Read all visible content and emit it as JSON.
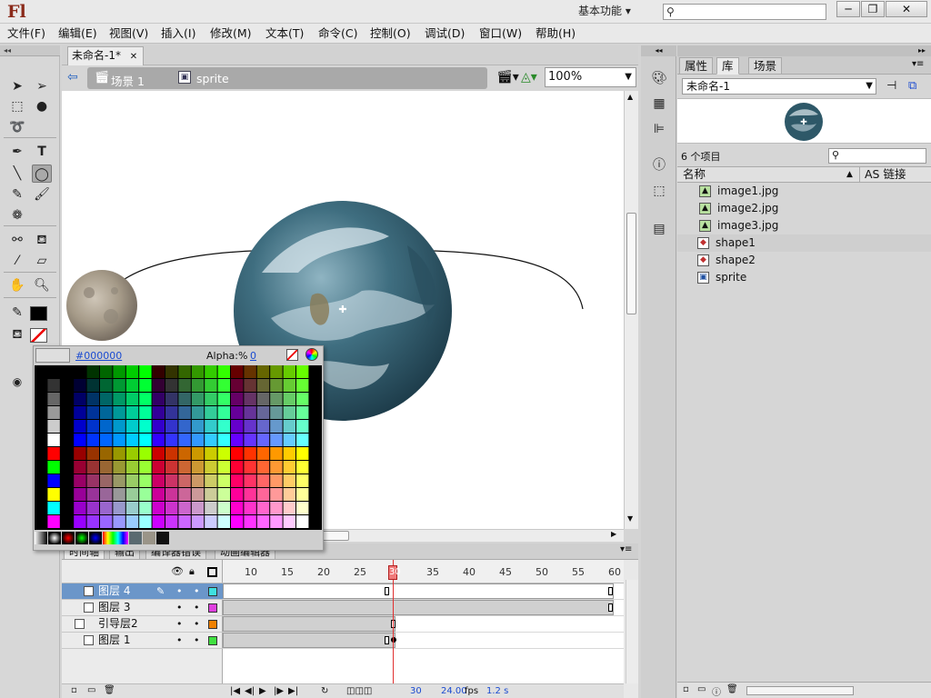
{
  "titlebar": {
    "logo": "Fl",
    "workspace": "基本功能",
    "search_placeholder": ""
  },
  "menu": [
    "文件(F)",
    "编辑(E)",
    "视图(V)",
    "插入(I)",
    "修改(M)",
    "文本(T)",
    "命令(C)",
    "控制(O)",
    "调试(D)",
    "窗口(W)",
    "帮助(H)"
  ],
  "document": {
    "tab": "未命名-1*",
    "breadcrumb": [
      "场景 1",
      "sprite"
    ],
    "zoom": "100%"
  },
  "color_popup": {
    "hex": "#000000",
    "alpha_label": "Alpha:%",
    "alpha_value": "0"
  },
  "timeline": {
    "tabs": [
      "时间轴",
      "输出",
      "编译器错误",
      "动画编辑器"
    ],
    "frame_numbers": [
      "10",
      "15",
      "20",
      "25",
      "30",
      "35",
      "40",
      "45",
      "50",
      "55",
      "60"
    ],
    "current_frame": "30",
    "fps": "24.00",
    "fps_unit": "fps",
    "seconds": "1.2 s",
    "layers": [
      {
        "name": "图层 4",
        "color": "#3fe0e0",
        "selected": true
      },
      {
        "name": "图层 3",
        "color": "#e040e0",
        "selected": false
      },
      {
        "name": "引导层2",
        "color": "#f08000",
        "selected": false
      },
      {
        "name": "图层 1",
        "color": "#40e040",
        "selected": false
      }
    ]
  },
  "library": {
    "tabs": [
      "属性",
      "库",
      "场景"
    ],
    "document": "未命名-1",
    "count": "6 个项目",
    "header_name": "名称",
    "header_link": "AS 链接",
    "items": [
      {
        "name": "image1.jpg",
        "type": "bitmap"
      },
      {
        "name": "image2.jpg",
        "type": "bitmap"
      },
      {
        "name": "image3.jpg",
        "type": "bitmap"
      },
      {
        "name": "shape1",
        "type": "graphic"
      },
      {
        "name": "shape2",
        "type": "graphic"
      },
      {
        "name": "sprite",
        "type": "movieclip"
      }
    ]
  },
  "colors": {
    "accent_selected": "#6b96c9",
    "playhead": "#e03030"
  }
}
